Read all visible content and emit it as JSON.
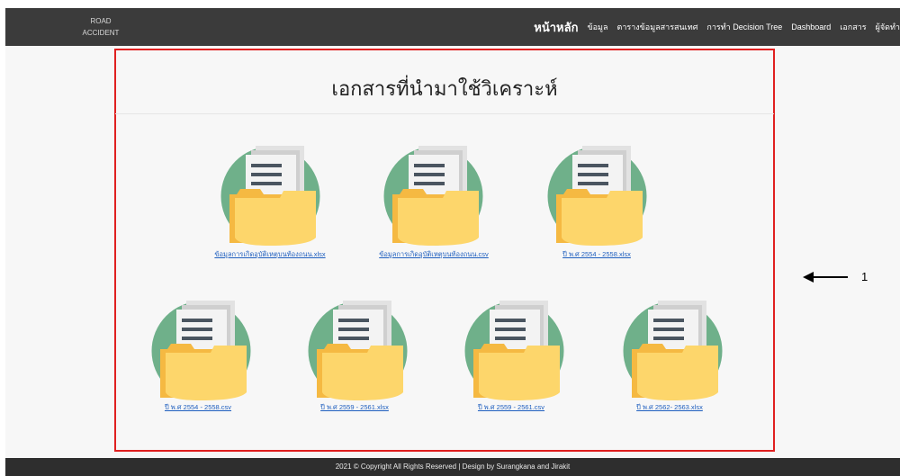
{
  "navbar": {
    "brand_line1": "ROAD",
    "brand_line2": "ACCIDENT",
    "items": [
      "หน้าหลัก",
      "ข้อมูล",
      "ตารางข้อมูลสารสนเทศ",
      "การทำ Decision Tree",
      "Dashboard",
      "เอกสาร",
      "ผู้จัดทำ"
    ]
  },
  "main": {
    "title": "เอกสารที่นำมาใช้วิเคราะห์",
    "documents": [
      {
        "label": "ข้อมูลการเกิดอุบัติเหตุบนท้องถนน.xlsx"
      },
      {
        "label": "ข้อมูลการเกิดอุบัติเหตุบนท้องถนน.csv"
      },
      {
        "label": "ปี พ.ศ 2554 - 2558.xlsx"
      },
      {
        "label": "ปี พ.ศ 2554 - 2558.csv"
      },
      {
        "label": "ปี พ.ศ 2559 - 2561.xlsx"
      },
      {
        "label": "ปี พ.ศ 2559 - 2561.csv"
      },
      {
        "label": "ปี พ.ศ 2562- 2563.xlsx"
      }
    ]
  },
  "annotation": {
    "label": "1"
  },
  "footer": {
    "text": "2021 © Copyright All Rights Reserved | Design by Surangkana and Jirakit"
  },
  "colors": {
    "circle": "#6fb08a",
    "folder": "#fdd66b",
    "folder_back": "#f5b942",
    "paper": "#f1f1f1",
    "lines": "#4a5560",
    "highlight": "#e02020"
  }
}
